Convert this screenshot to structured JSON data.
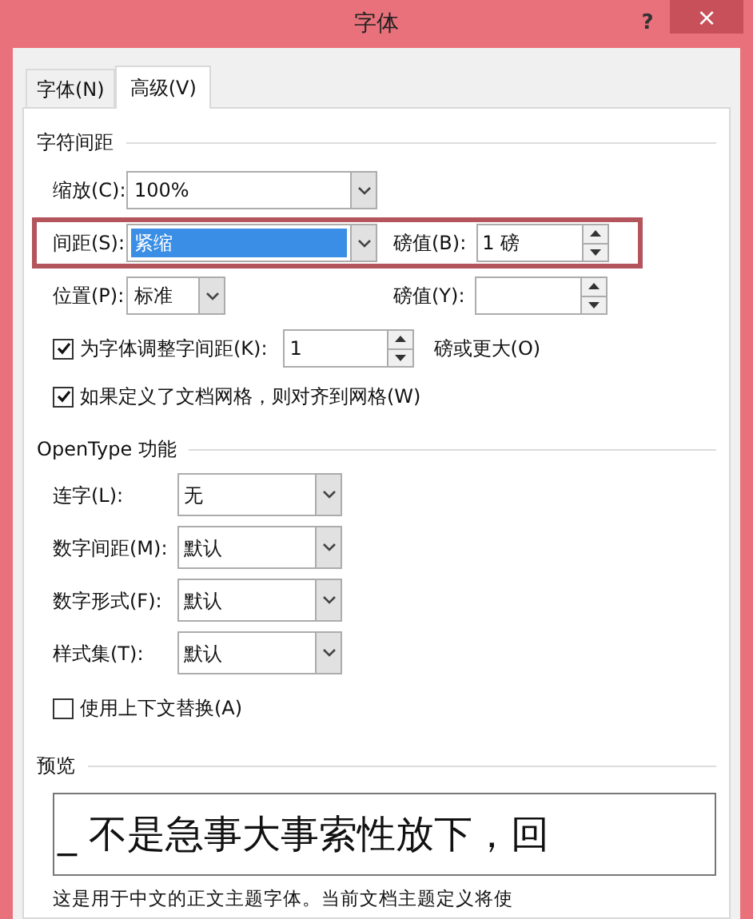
{
  "window": {
    "title": "字体",
    "help": "?",
    "close": "×"
  },
  "tabs": [
    {
      "label": "字体(N)",
      "selected": false
    },
    {
      "label": "高级(V)",
      "selected": true
    }
  ],
  "spacing": {
    "title": "字符间距",
    "rows": [
      {
        "kind": "combo",
        "label": "缩放(C):",
        "value": "100%",
        "highlighted": false,
        "value_selected": false
      },
      {
        "kind": "combo",
        "label": "间距(S):",
        "value": "紧缩",
        "highlighted": true,
        "value_selected": true,
        "points_label": "磅值(B):",
        "points_value": "1 磅"
      },
      {
        "kind": "short",
        "label": "位置(P):",
        "value": "标准",
        "highlighted": false,
        "value_selected": false,
        "points_label": "磅值(Y):"
      }
    ],
    "kerning": {
      "checked": true,
      "label": "为字体调整字间距(K):",
      "value": "1",
      "suffix": "磅或更大(O)"
    },
    "grid": {
      "checked": true,
      "label": "如果定义了文档网格，则对齐到网格(W)"
    }
  },
  "opentype": {
    "title": "OpenType 功能",
    "dropdowns": [
      {
        "label": "连字(L):",
        "value": "无"
      },
      {
        "label": "数字间距(M):",
        "value": "默认"
      },
      {
        "label": "数字形式(F):",
        "value": "默认"
      },
      {
        "label": "样式集(T):",
        "value": "默认"
      }
    ],
    "contextual": {
      "checked": false,
      "label": "使用上下文替换(A)"
    }
  },
  "preview": {
    "title": "预览",
    "text": "_ 不是急事大事索性放下，回",
    "caption": "这是用于中文的正文主题字体。当前文档主题定义将使"
  }
}
